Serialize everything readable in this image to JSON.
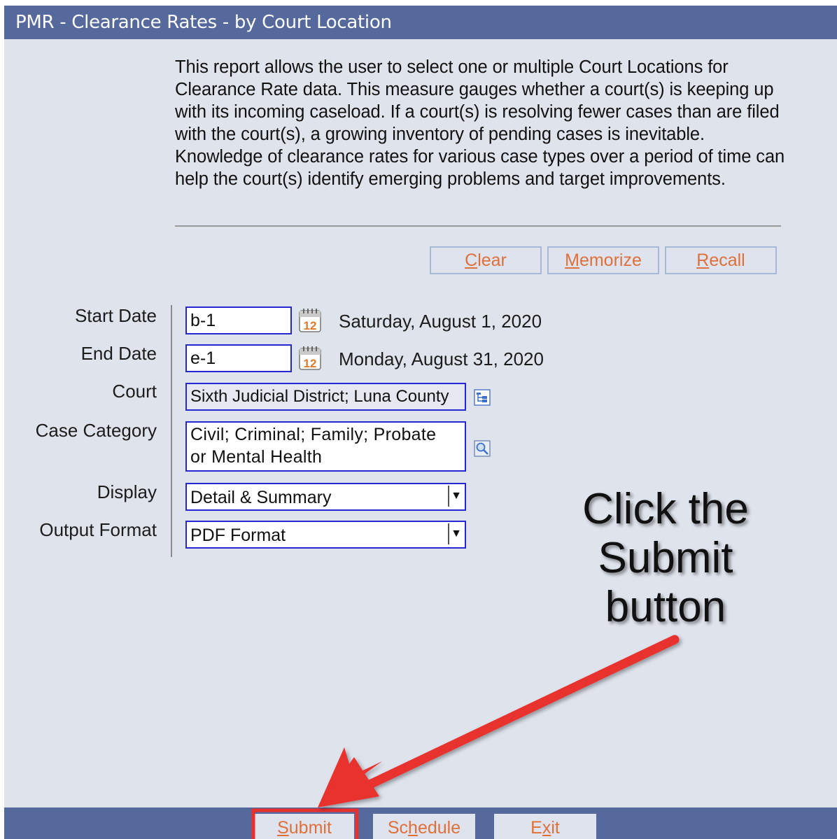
{
  "window": {
    "title": "PMR - Clearance Rates - by Court Location"
  },
  "description": "This report allows the user to select one or multiple Court Locations for Clearance Rate data. This measure gauges whether a court(s) is keeping up with its incoming caseload. If a court(s) is resolving fewer cases than are filed with the court(s), a growing inventory of pending cases is inevitable. Knowledge of clearance rates for various case types over a period of time can help the court(s) identify emerging problems and target improvements.",
  "top_buttons": {
    "clear": {
      "accel": "C",
      "rest": "lear"
    },
    "memorize": {
      "accel": "M",
      "rest": "emorize"
    },
    "recall": {
      "accel": "R",
      "rest": "ecall"
    }
  },
  "form": {
    "start_date": {
      "label": "Start Date",
      "value": "b-1",
      "resolved": "Saturday, August 1, 2020"
    },
    "end_date": {
      "label": "End Date",
      "value": "e-1",
      "resolved": "Monday, August 31, 2020"
    },
    "court": {
      "label": "Court",
      "value": "Sixth Judicial District; Luna County"
    },
    "case_category": {
      "label": "Case Category",
      "value": "Civil; Criminal; Family; Probate or Mental Health"
    },
    "display": {
      "label": "Display",
      "value": "Detail & Summary"
    },
    "output_format": {
      "label": "Output Format",
      "value": "PDF Format"
    },
    "calendar_icon_text": "12"
  },
  "bottom_buttons": {
    "submit": {
      "accel": "S",
      "rest": "ubmit"
    },
    "schedule": {
      "pre": "Sc",
      "accel": "h",
      "rest": "edule"
    },
    "exit": {
      "pre": "E",
      "accel": "x",
      "rest": "it"
    }
  },
  "annotation": {
    "line1": "Click the",
    "line2": "Submit",
    "line3": "button"
  },
  "colors": {
    "titlebar": "#56699c",
    "panel": "#dfe3ec",
    "field_border": "#2727d6",
    "button_text": "#e0703a",
    "highlight": "#e8302e"
  }
}
